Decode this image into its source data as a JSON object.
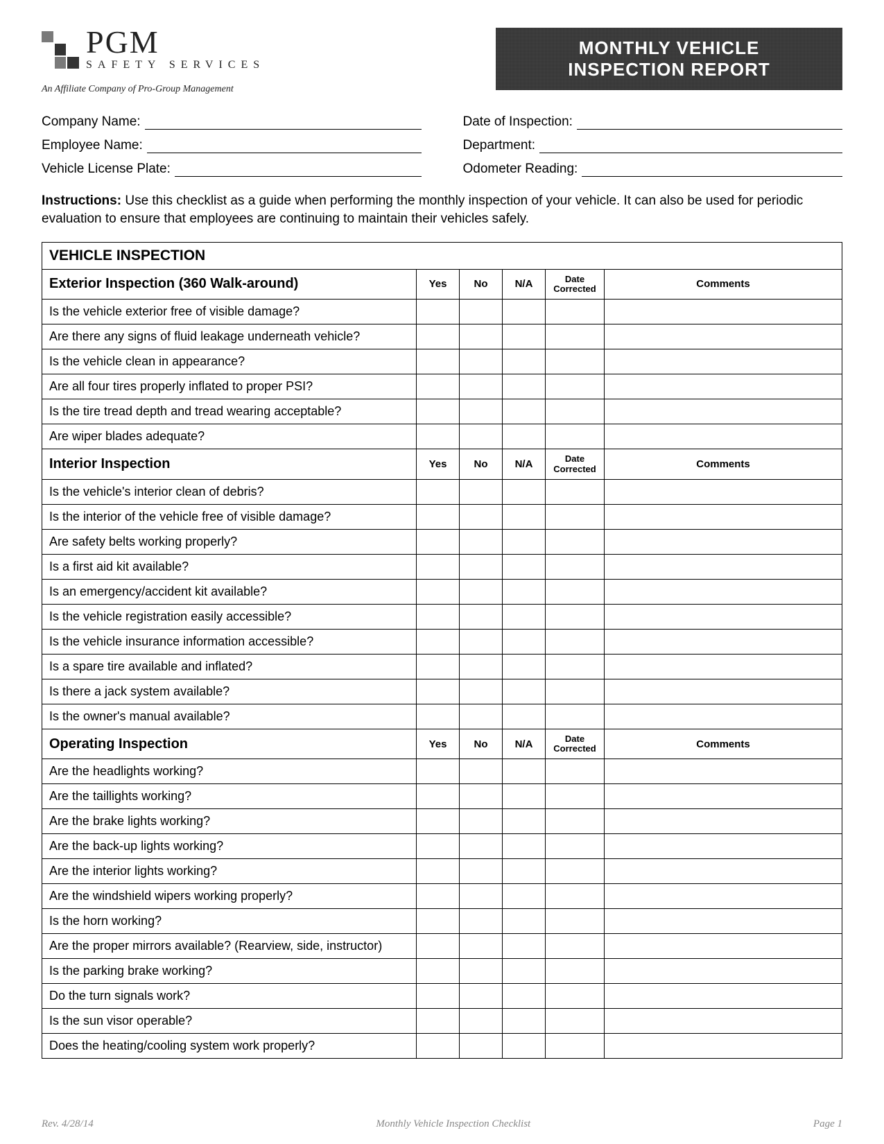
{
  "logo": {
    "name": "PGM",
    "subtitle": "SAFETY SERVICES",
    "affiliate": "An Affiliate Company of Pro-Group Management"
  },
  "title": {
    "line1": "MONTHLY VEHICLE",
    "line2": "INSPECTION REPORT"
  },
  "info": {
    "company_label": "Company Name:",
    "date_label": "Date of Inspection:",
    "employee_label": "Employee Name:",
    "department_label": "Department:",
    "plate_label": "Vehicle License Plate:",
    "odometer_label": "Odometer Reading:"
  },
  "instructions_bold": "Instructions:",
  "instructions_text": " Use this checklist as a guide when performing the monthly inspection of your vehicle. It can also be used for periodic evaluation to ensure that employees are continuing to maintain their vehicles safely.",
  "table_title": "VEHICLE INSPECTION",
  "col": {
    "yes": "Yes",
    "no": "No",
    "na": "N/A",
    "date": "Date Corrected",
    "comments": "Comments"
  },
  "sections": [
    {
      "heading": "Exterior Inspection (360 Walk-around)",
      "items": [
        "Is the vehicle exterior free of visible damage?",
        "Are there any signs of fluid leakage underneath vehicle?",
        "Is the vehicle clean in appearance?",
        "Are all four tires properly inflated to proper  PSI?",
        "Is the tire tread depth and tread wearing acceptable?",
        "Are wiper blades adequate?"
      ]
    },
    {
      "heading": "Interior Inspection",
      "items": [
        "Is the vehicle's interior clean of debris?",
        "Is the interior of the vehicle free of visible damage?",
        "Are safety belts working properly?",
        "Is a first aid kit available?",
        "Is an emergency/accident kit available?",
        "Is the vehicle registration easily accessible?",
        "Is the vehicle insurance information accessible?",
        "Is a spare tire available and inflated?",
        "Is there a jack system available?",
        "Is the owner's manual available?"
      ]
    },
    {
      "heading": "Operating Inspection",
      "items": [
        "Are the headlights working?",
        "Are the taillights working?",
        "Are the brake lights working?",
        "Are the back-up lights working?",
        "Are the interior lights working?",
        "Are the windshield wipers working properly?",
        "Is the horn working?",
        "Are the proper mirrors available? (Rearview, side, instructor)",
        "Is the parking brake working?",
        "Do the turn signals work?",
        "Is the sun visor operable?",
        "Does the heating/cooling system work properly?"
      ]
    }
  ],
  "footer": {
    "rev": "Rev. 4/28/14",
    "center": "Monthly Vehicle Inspection Checklist",
    "page": "Page 1"
  }
}
